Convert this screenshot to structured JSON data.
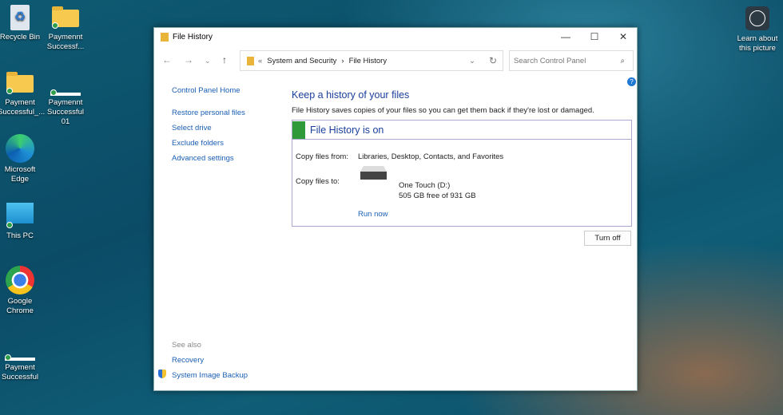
{
  "desktop": {
    "icons": [
      {
        "label": "Recycle Bin",
        "icon": "recycle-bin-icon"
      },
      {
        "label": "Paymennt Successf...",
        "icon": "folder-icon"
      },
      {
        "label": "Payment Successful_...",
        "icon": "folder-icon"
      },
      {
        "label": "Paymennt Successful 01",
        "icon": "file-bar-icon"
      },
      {
        "label": "Microsoft Edge",
        "icon": "edge-icon"
      },
      {
        "label": "This PC",
        "icon": "monitor-icon"
      },
      {
        "label": "Google Chrome",
        "icon": "chrome-icon"
      },
      {
        "label": "Payment Successful",
        "icon": "file-bar-icon"
      }
    ],
    "learn_about": "Learn about this picture"
  },
  "window": {
    "title": "File History",
    "address": {
      "sep": "«",
      "crumb1": "System and Security",
      "crumb2": "File History"
    },
    "search_placeholder": "Search Control Panel",
    "sidebar": {
      "home": "Control Panel Home",
      "links": [
        "Restore personal files",
        "Select drive",
        "Exclude folders",
        "Advanced settings"
      ],
      "see_also": "See also",
      "see_links": [
        "Recovery",
        "System Image Backup"
      ]
    },
    "main": {
      "heading": "Keep a history of your files",
      "description": "File History saves copies of your files so you can get them back if they're lost or damaged.",
      "status": "File History is on",
      "status_color": "#2f9a3a",
      "copy_from_label": "Copy files from:",
      "copy_from_value": "Libraries, Desktop, Contacts, and Favorites",
      "copy_to_label": "Copy files to:",
      "drive_name": "One Touch (D:)",
      "drive_space": "505 GB free of 931 GB",
      "run_now": "Run now",
      "turn_off": "Turn off"
    }
  }
}
